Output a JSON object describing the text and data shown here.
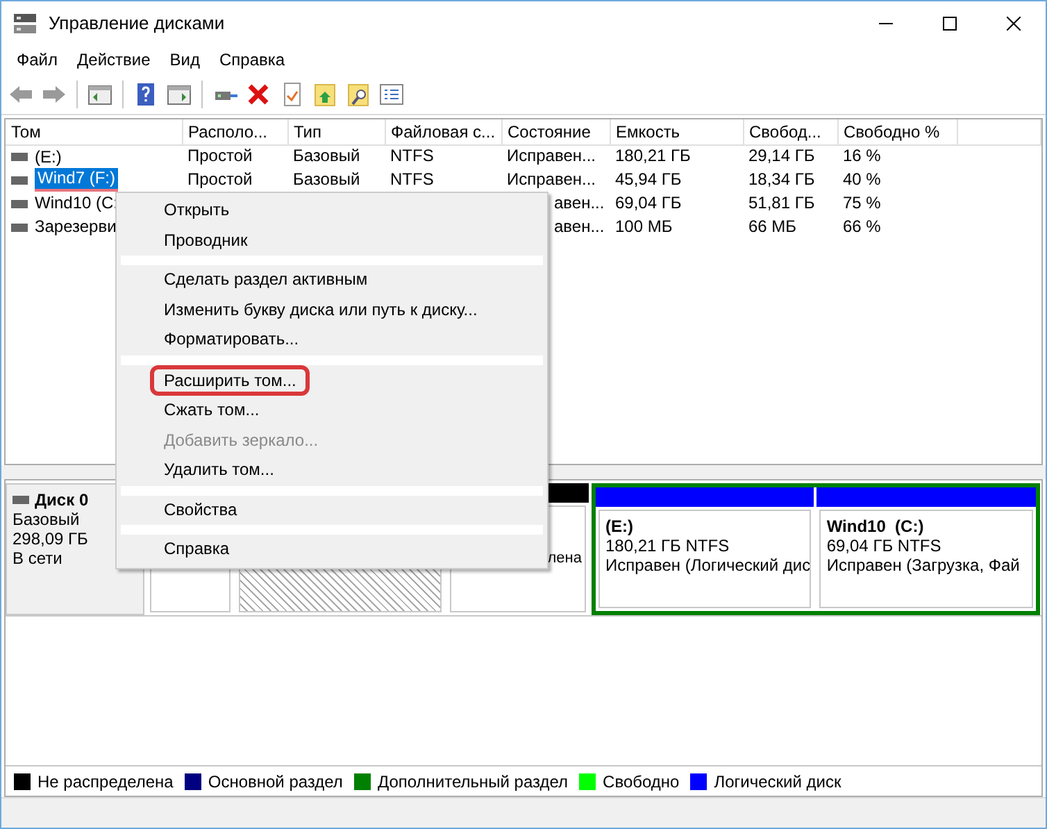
{
  "window": {
    "title": "Управление дисками"
  },
  "menu": [
    "Файл",
    "Действие",
    "Вид",
    "Справка"
  ],
  "table": {
    "columns": [
      "Том",
      "Располо...",
      "Тип",
      "Файловая с...",
      "Состояние",
      "Емкость",
      "Свобод...",
      "Свободно %"
    ],
    "rows": [
      {
        "selected": false,
        "annotated": false,
        "covered": false,
        "cells": [
          "(E:)",
          "Простой",
          "Базовый",
          "NTFS",
          "Исправен...",
          "180,21 ГБ",
          "29,14 ГБ",
          "16 %"
        ]
      },
      {
        "selected": true,
        "annotated": true,
        "covered": false,
        "cells": [
          "Wind7 (F:)",
          "Простой",
          "Базовый",
          "NTFS",
          "Исправен...",
          "45,94 ГБ",
          "18,34 ГБ",
          "40 %"
        ]
      },
      {
        "selected": false,
        "annotated": false,
        "covered": true,
        "cells": [
          "Wind10 (C:",
          "",
          "",
          "",
          "авен...",
          "69,04 ГБ",
          "51,81 ГБ",
          "75 %"
        ]
      },
      {
        "selected": false,
        "annotated": false,
        "covered": true,
        "cells": [
          "Зарезерви",
          "",
          "",
          "",
          "авен...",
          "100 МБ",
          "66 МБ",
          "66 %"
        ]
      }
    ]
  },
  "context_menu": {
    "groups": [
      [
        {
          "label": "Открыть",
          "disabled": false,
          "highlighted": false
        },
        {
          "label": "Проводник",
          "disabled": false,
          "highlighted": false
        }
      ],
      [
        {
          "label": "Сделать раздел активным",
          "disabled": false,
          "highlighted": false
        },
        {
          "label": "Изменить букву диска или путь к диску...",
          "disabled": false,
          "highlighted": false
        },
        {
          "label": "Форматировать...",
          "disabled": false,
          "highlighted": false
        }
      ],
      [
        {
          "label": "Расширить том...",
          "disabled": false,
          "highlighted": true
        },
        {
          "label": "Сжать том...",
          "disabled": false,
          "highlighted": false
        },
        {
          "label": "Добавить зеркало...",
          "disabled": true,
          "highlighted": false
        },
        {
          "label": "Удалить том...",
          "disabled": false,
          "highlighted": false
        }
      ],
      [
        {
          "label": "Свойства",
          "disabled": false,
          "highlighted": false
        }
      ],
      [
        {
          "label": "Справка",
          "disabled": false,
          "highlighted": false
        }
      ]
    ]
  },
  "disk": {
    "name": "Диск 0",
    "type": "Базовый",
    "size": "298,09 ГБ",
    "status": "В сети",
    "partitions": [
      {
        "kind": "plain"
      },
      {
        "kind": "hatched"
      },
      {
        "kind": "plain",
        "color": "#000000",
        "text": "лена"
      }
    ],
    "extended": {
      "color": "#008000",
      "logical": [
        {
          "color": "#0000ff",
          "name": "(E:)",
          "size": "180,21 ГБ NTFS",
          "status": "Исправен (Логический дис"
        },
        {
          "color": "#0000ff",
          "name": "Wind10  (C:)",
          "size": "69,04 ГБ NTFS",
          "status": "Исправен (Загрузка, Фай"
        }
      ]
    }
  },
  "legend": [
    {
      "color": "#000000",
      "label": "Не распределена"
    },
    {
      "color": "#000080",
      "label": "Основной раздел"
    },
    {
      "color": "#008000",
      "label": "Дополнительный раздел"
    },
    {
      "color": "#00ff00",
      "label": "Свободно"
    },
    {
      "color": "#0000ff",
      "label": "Логический диск"
    }
  ]
}
